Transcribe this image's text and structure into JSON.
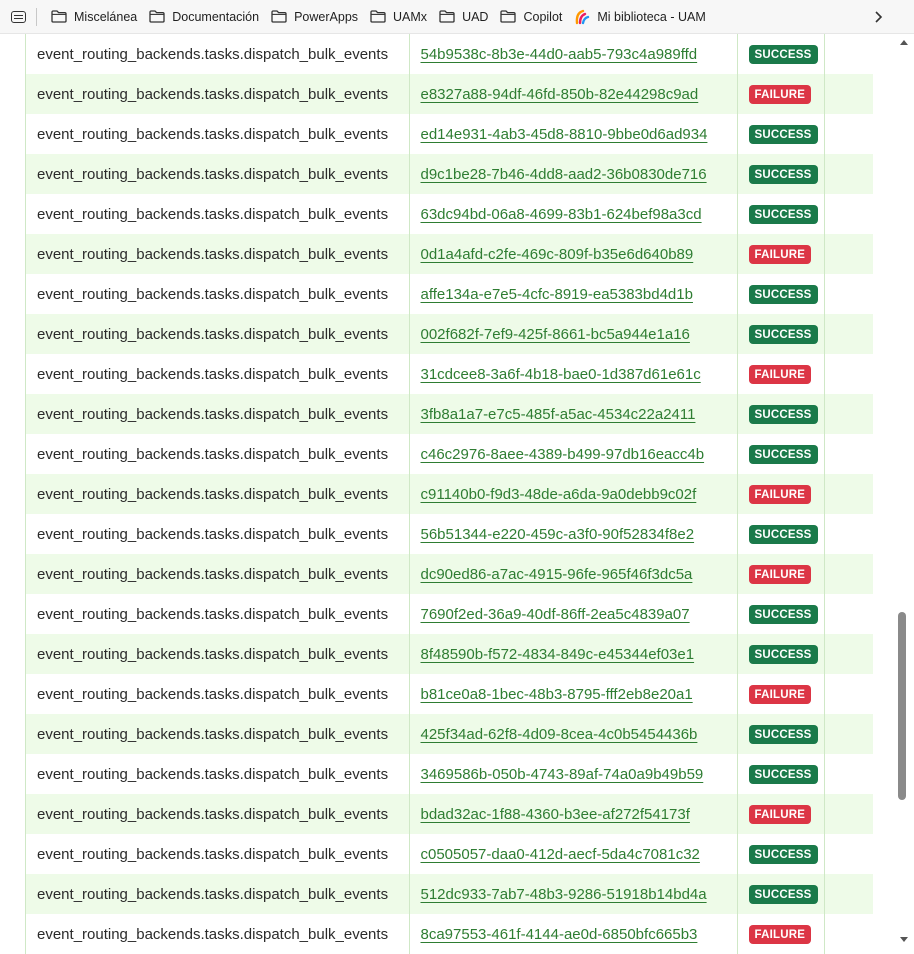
{
  "bookmarks": {
    "items": [
      {
        "label": "Miscelánea",
        "icon": "folder-icon"
      },
      {
        "label": "Documentación",
        "icon": "folder-icon"
      },
      {
        "label": "PowerApps",
        "icon": "folder-icon"
      },
      {
        "label": "UAMx",
        "icon": "folder-icon"
      },
      {
        "label": "UAD",
        "icon": "folder-icon"
      },
      {
        "label": "Copilot",
        "icon": "folder-icon"
      },
      {
        "label": "Mi biblioteca - UAM",
        "icon": "library-icon"
      }
    ]
  },
  "table": {
    "rows": [
      {
        "name": "event_routing_backends.tasks.dispatch_bulk_events",
        "task_id": "54b9538c-8b3e-44d0-aab5-793c4a989ffd",
        "status": "SUCCESS"
      },
      {
        "name": "event_routing_backends.tasks.dispatch_bulk_events",
        "task_id": "e8327a88-94df-46fd-850b-82e44298c9ad",
        "status": "FAILURE"
      },
      {
        "name": "event_routing_backends.tasks.dispatch_bulk_events",
        "task_id": "ed14e931-4ab3-45d8-8810-9bbe0d6ad934",
        "status": "SUCCESS"
      },
      {
        "name": "event_routing_backends.tasks.dispatch_bulk_events",
        "task_id": "d9c1be28-7b46-4dd8-aad2-36b0830de716",
        "status": "SUCCESS"
      },
      {
        "name": "event_routing_backends.tasks.dispatch_bulk_events",
        "task_id": "63dc94bd-06a8-4699-83b1-624bef98a3cd",
        "status": "SUCCESS"
      },
      {
        "name": "event_routing_backends.tasks.dispatch_bulk_events",
        "task_id": "0d1a4afd-c2fe-469c-809f-b35e6d640b89",
        "status": "FAILURE"
      },
      {
        "name": "event_routing_backends.tasks.dispatch_bulk_events",
        "task_id": "affe134a-e7e5-4cfc-8919-ea5383bd4d1b",
        "status": "SUCCESS"
      },
      {
        "name": "event_routing_backends.tasks.dispatch_bulk_events",
        "task_id": "002f682f-7ef9-425f-8661-bc5a944e1a16",
        "status": "SUCCESS"
      },
      {
        "name": "event_routing_backends.tasks.dispatch_bulk_events",
        "task_id": "31cdcee8-3a6f-4b18-bae0-1d387d61e61c",
        "status": "FAILURE"
      },
      {
        "name": "event_routing_backends.tasks.dispatch_bulk_events",
        "task_id": "3fb8a1a7-e7c5-485f-a5ac-4534c22a2411",
        "status": "SUCCESS"
      },
      {
        "name": "event_routing_backends.tasks.dispatch_bulk_events",
        "task_id": "c46c2976-8aee-4389-b499-97db16eacc4b",
        "status": "SUCCESS"
      },
      {
        "name": "event_routing_backends.tasks.dispatch_bulk_events",
        "task_id": "c91140b0-f9d3-48de-a6da-9a0debb9c02f",
        "status": "FAILURE"
      },
      {
        "name": "event_routing_backends.tasks.dispatch_bulk_events",
        "task_id": "56b51344-e220-459c-a3f0-90f52834f8e2",
        "status": "SUCCESS"
      },
      {
        "name": "event_routing_backends.tasks.dispatch_bulk_events",
        "task_id": "dc90ed86-a7ac-4915-96fe-965f46f3dc5a",
        "status": "FAILURE"
      },
      {
        "name": "event_routing_backends.tasks.dispatch_bulk_events",
        "task_id": "7690f2ed-36a9-40df-86ff-2ea5c4839a07",
        "status": "SUCCESS"
      },
      {
        "name": "event_routing_backends.tasks.dispatch_bulk_events",
        "task_id": "8f48590b-f572-4834-849c-e45344ef03e1",
        "status": "SUCCESS"
      },
      {
        "name": "event_routing_backends.tasks.dispatch_bulk_events",
        "task_id": "b81ce0a8-1bec-48b3-8795-fff2eb8e20a1",
        "status": "FAILURE"
      },
      {
        "name": "event_routing_backends.tasks.dispatch_bulk_events",
        "task_id": "425f34ad-62f8-4d09-8cea-4c0b5454436b",
        "status": "SUCCESS"
      },
      {
        "name": "event_routing_backends.tasks.dispatch_bulk_events",
        "task_id": "3469586b-050b-4743-89af-74a0a9b49b59",
        "status": "SUCCESS"
      },
      {
        "name": "event_routing_backends.tasks.dispatch_bulk_events",
        "task_id": "bdad32ac-1f88-4360-b3ee-af272f54173f",
        "status": "FAILURE"
      },
      {
        "name": "event_routing_backends.tasks.dispatch_bulk_events",
        "task_id": "c0505057-daa0-412d-aecf-5da4c7081c32",
        "status": "SUCCESS"
      },
      {
        "name": "event_routing_backends.tasks.dispatch_bulk_events",
        "task_id": "512dc933-7ab7-48b3-9286-51918b14bd4a",
        "status": "SUCCESS"
      },
      {
        "name": "event_routing_backends.tasks.dispatch_bulk_events",
        "task_id": "8ca97553-461f-4144-ae0d-6850bfc665b3",
        "status": "FAILURE"
      }
    ]
  },
  "colors": {
    "success": "#1a7a4a",
    "failure": "#dc3545",
    "link": "#2e7d32",
    "row_alt": "#eefbe8"
  }
}
